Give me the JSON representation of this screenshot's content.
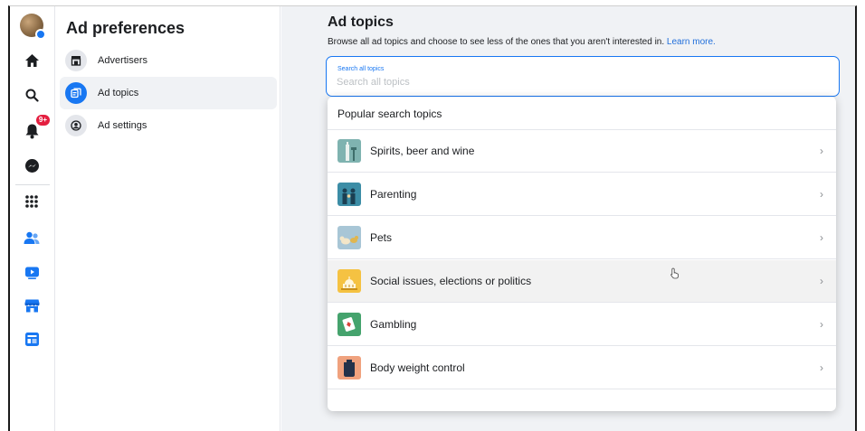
{
  "sidebar": {
    "title": "Ad preferences",
    "items": [
      {
        "label": "Advertisers",
        "icon": "storefront-icon"
      },
      {
        "label": "Ad topics",
        "icon": "ad-topics-icon",
        "active": true
      },
      {
        "label": "Ad settings",
        "icon": "user-settings-icon"
      }
    ]
  },
  "rail": {
    "notification_count": "9+",
    "icons": [
      "avatar",
      "home-icon",
      "search-icon",
      "notifications-icon",
      "messenger-icon",
      "apps-grid-icon",
      "friends-icon",
      "watch-icon",
      "marketplace-icon",
      "feeds-icon"
    ]
  },
  "main": {
    "title": "Ad topics",
    "subtitle": "Browse all ad topics and choose to see less of the ones that you aren't interested in.",
    "learn_more": "Learn more.",
    "search": {
      "label": "Search all topics",
      "placeholder": "Search all topics"
    },
    "dropdown": {
      "heading": "Popular search topics",
      "topics": [
        {
          "label": "Spirits, beer and wine",
          "color": "#7fb3b0"
        },
        {
          "label": "Parenting",
          "color": "#3c8da6"
        },
        {
          "label": "Pets",
          "color": "#a8c6d6"
        },
        {
          "label": "Social issues, elections or politics",
          "color": "#f5c242"
        },
        {
          "label": "Gambling",
          "color": "#45a36d"
        },
        {
          "label": "Body weight control",
          "color": "#f0a27e"
        }
      ]
    }
  },
  "colors": {
    "accent": "#1877f2",
    "link": "#216fdb",
    "badge": "#e41e3f"
  }
}
